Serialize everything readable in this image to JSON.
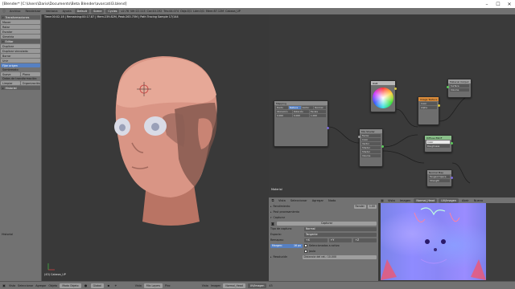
{
  "window": {
    "title": "[Blender* [C:\\Users\\Dario\\Documents\\Beta Blender\\avarcatil3.blend]",
    "controls": [
      "–",
      "☐",
      "✕"
    ]
  },
  "info_header": {
    "menus": [
      "Archivo",
      "Renderizar",
      "Ventana",
      "Ayuda"
    ],
    "layout": "Default",
    "scene": "Scene",
    "engine": "Cycles",
    "stats": [
      "v2.76",
      "Vér:22.113",
      "Car:44.192",
      "Tris:44.074",
      "Objs:0/1",
      "Lám:0/1",
      "Mem:87.12M",
      "Cabeza_UP"
    ]
  },
  "toolshelf": {
    "sections": [
      {
        "label": "Transformaciones",
        "items": [
          "Mover",
          "Rotar",
          "Escalar",
          "Simetría"
        ]
      },
      {
        "label": "Editar",
        "items": [
          "Duplicar",
          "Duplicar vinculado",
          "Borrar",
          "Unir"
        ]
      }
    ],
    "set_origin": "Fijar origen",
    "shading_label": "Sombreado:",
    "shading": [
      "Suave",
      "Plano"
    ],
    "datos_transf_label": "Datos de transformación:",
    "limpiar": "Limpiar",
    "organizacion": "Organización",
    "historial": "Historial",
    "bottom_label": "Historial"
  },
  "viewport": {
    "render_info": "Time:00:02.18 | Remaining:00:17.87 | Mem:239.82M, Peak:263.75M | Path Tracing Sample 17/144",
    "object_label": "(43) Cabeza_UP"
  },
  "node_editor": {
    "label": "Material",
    "nodes": {
      "mapping": {
        "title": "Mapping",
        "tabs": [
          "Punto",
          "Textura",
          "Vector",
          "Normal"
        ],
        "rows": [
          "Ubicación",
          "Rotación",
          "Escala",
          "0.000",
          "0.000",
          "1.000"
        ]
      },
      "mix": {
        "title": "Mix Shader",
        "rows": [
          "Factor",
          "Color",
          "Vector",
          "Shader",
          "Shader",
          "Volume"
        ]
      },
      "color": {
        "title": "RGB"
      },
      "texture": {
        "title": "Image Texture",
        "rows": [
          "Color",
          "Alpha"
        ]
      },
      "out": {
        "title": "Material Output",
        "rows": [
          "Surface",
          "Volume",
          "Displacement"
        ]
      },
      "ramp": {
        "title": "Diffuse BSDF",
        "rows": [
          "Color",
          "Roughness"
        ]
      },
      "bottom": {
        "title": "Normal Map",
        "rows": [
          "Tangent Space",
          "Strength"
        ]
      }
    }
  },
  "properties": {
    "header_items": [
      "Vista",
      "Seleccionar",
      "Agregar",
      "Nodo"
    ],
    "rows": [
      {
        "type": "field",
        "label": "Rendimiento",
        "value": "Render",
        "right": "1.00"
      },
      {
        "type": "section",
        "label": "Post procesamiento"
      },
      {
        "type": "section",
        "label": "Capturar"
      }
    ],
    "bake_button": "Capturar",
    "bake_type_label": "Tipo de captura:",
    "bake_type": "Normal",
    "space_label": "Espacio:",
    "space": "Tangente",
    "swizzle_label": "Remapeo:",
    "swizzle": [
      "+X",
      "+Y",
      "+Z"
    ],
    "margin_label": "Margen:",
    "margin": "16 px",
    "selected_to_active": "Seleccionados a activo",
    "cage": "Jaula",
    "distance": "Distancia del rat.: 10.000",
    "resolution_label": "Resolución"
  },
  "uv_editor": {
    "header_items": [
      "Vista",
      "Imagen"
    ],
    "image_name": "Normal_Head",
    "mode": "UV/Imagen",
    "right_items": [
      "Abrir",
      "Nuevo"
    ]
  },
  "statusbar": {
    "items": [
      "Vista",
      "Seleccionar",
      "Agregar",
      "Objeto",
      "Modo Objeto",
      "Global"
    ],
    "right_items": [
      "Vista",
      "Mix Layers",
      "Pinc"
    ],
    "uv_items": [
      "Vista",
      "Imagen",
      "Normal_Head",
      "UV/Imagen"
    ],
    "frame": "43"
  },
  "colors": {
    "panel": "#727272",
    "viewport": "#393939",
    "accent_blue": "#5680c2",
    "skin": "#e1a08f",
    "socket_yellow": "#d6c446",
    "socket_gray": "#9a9a9a",
    "socket_purple": "#7a6ad6",
    "socket_green": "#5ac85a"
  }
}
